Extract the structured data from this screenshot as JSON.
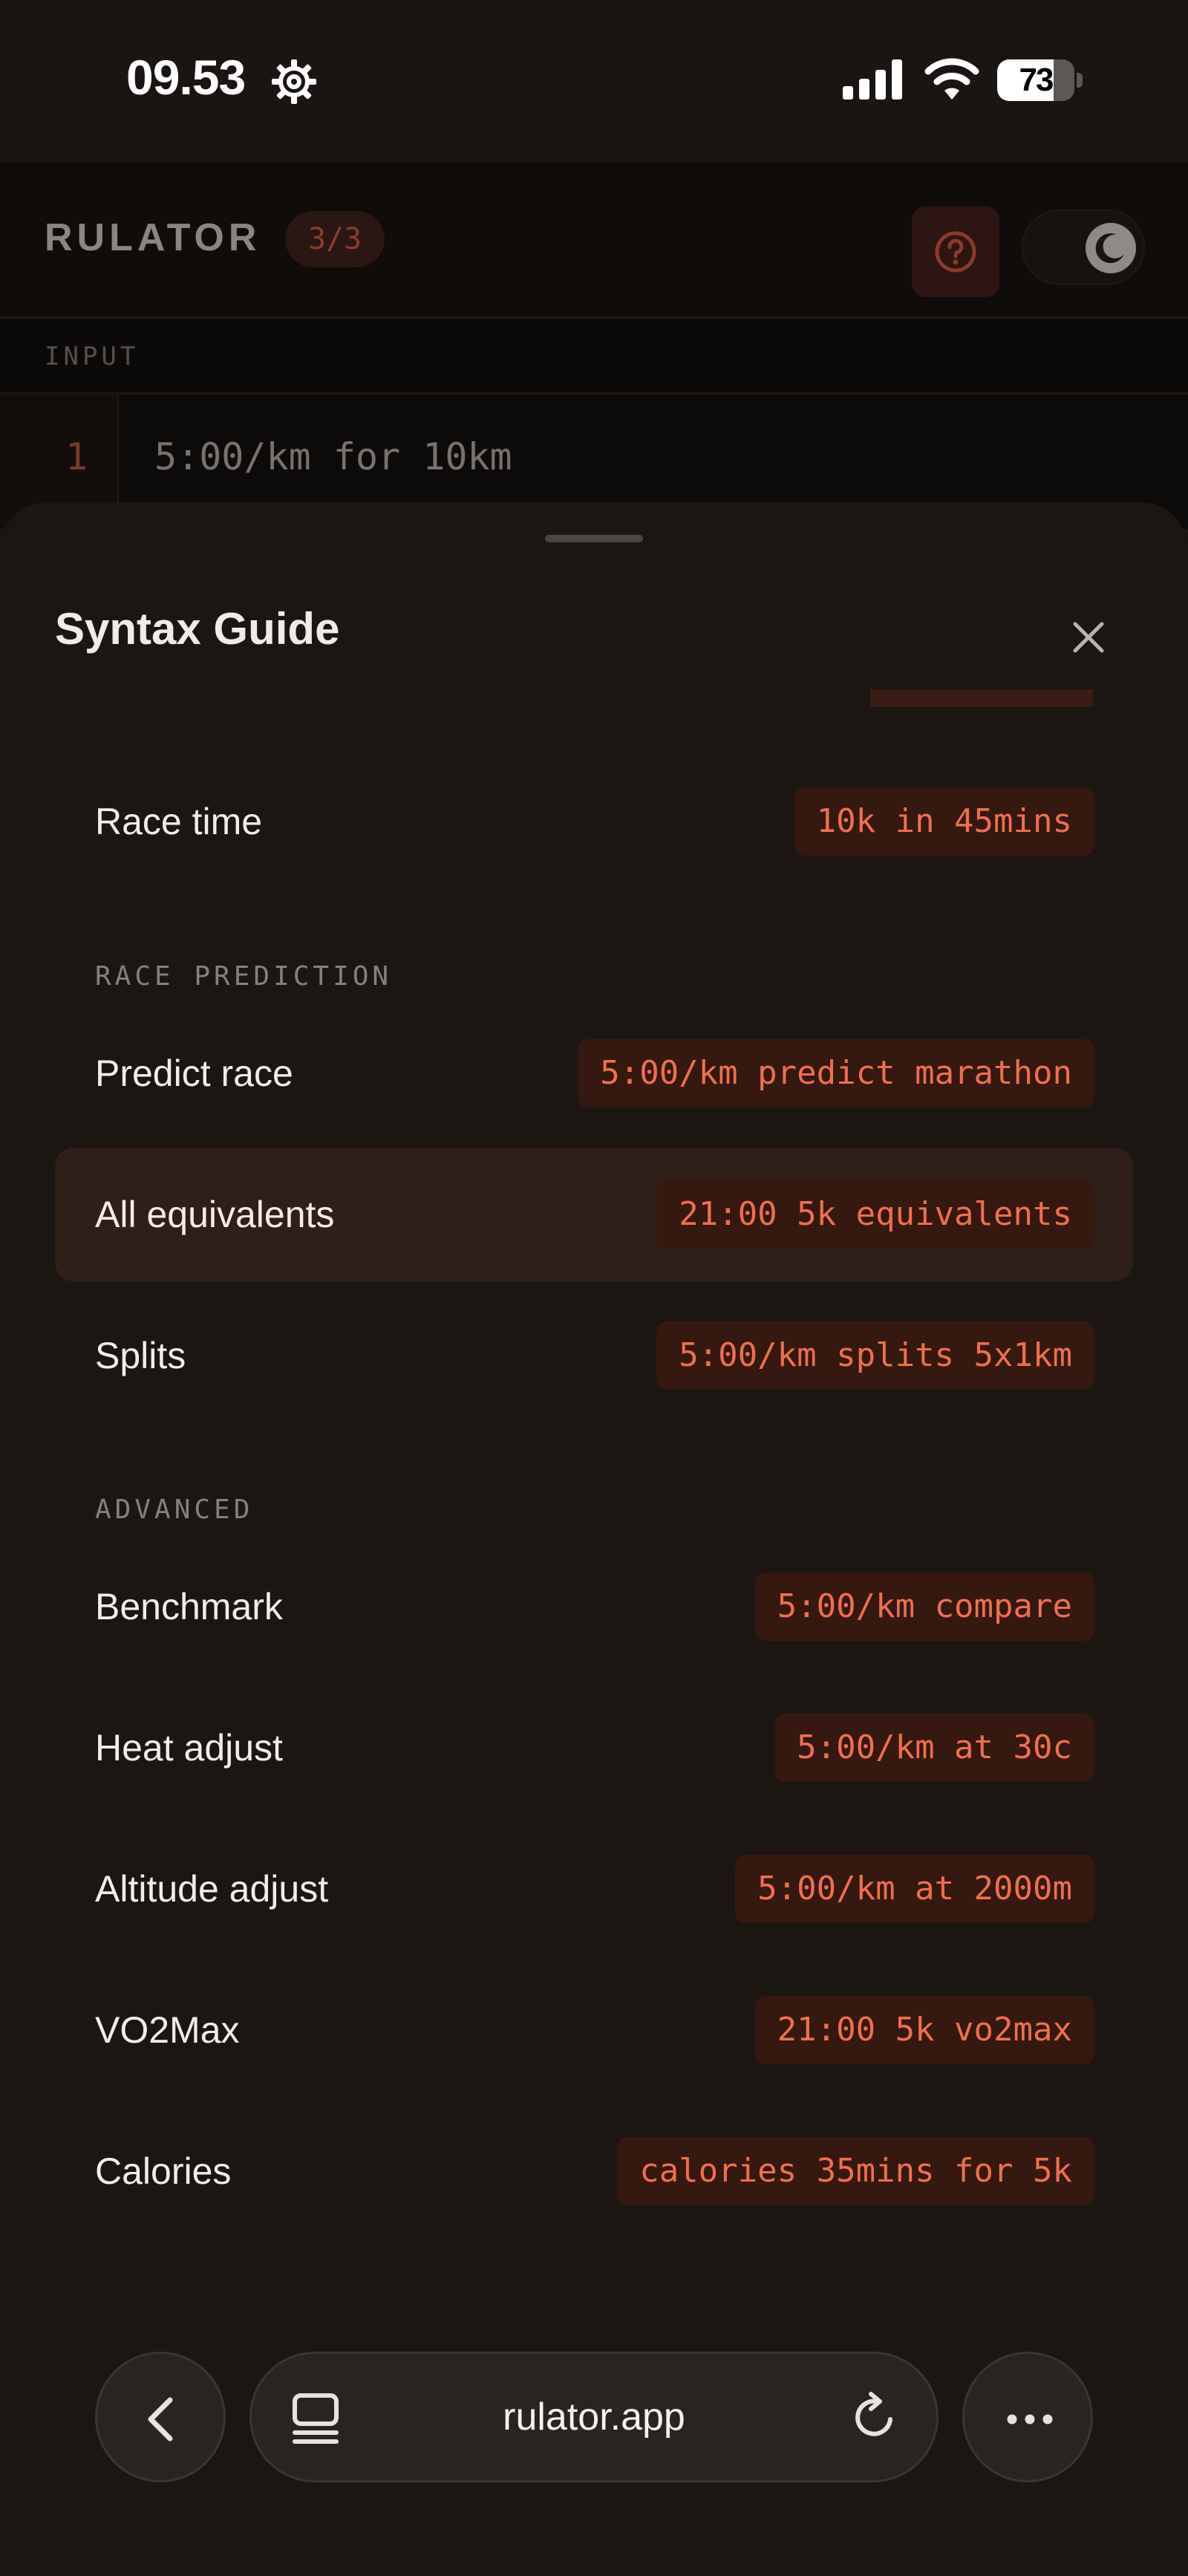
{
  "status_bar": {
    "time": "09.53",
    "battery_level": "73",
    "icons": [
      "gear-icon",
      "cellular-signal-icon",
      "wifi-icon",
      "battery-icon"
    ]
  },
  "app": {
    "title": "RULATOR",
    "counter": "3/3",
    "help_icon": "question-circle-icon",
    "theme_icon": "moon-icon",
    "input_section_label": "INPUT",
    "editor": {
      "line_number": "1",
      "line_text": "5:00/km for 10km"
    },
    "accent_color": "#ef6f4e"
  },
  "sheet": {
    "title": "Syntax Guide",
    "close_icon": "close-icon",
    "rows_top": [
      {
        "label": "Race time",
        "example": "10k in 45mins"
      }
    ],
    "sections": [
      {
        "heading": "RACE PREDICTION",
        "rows": [
          {
            "label": "Predict race",
            "example": "5:00/km predict marathon"
          },
          {
            "label": "All equivalents",
            "example": "21:00 5k equivalents",
            "highlighted": true
          },
          {
            "label": "Splits",
            "example": "5:00/km splits 5x1km"
          }
        ]
      },
      {
        "heading": "ADVANCED",
        "rows": [
          {
            "label": "Benchmark",
            "example": "5:00/km compare"
          },
          {
            "label": "Heat adjust",
            "example": "5:00/km at 30c"
          },
          {
            "label": "Altitude adjust",
            "example": "5:00/km at 2000m"
          },
          {
            "label": "VO2Max",
            "example": "21:00 5k vo2max"
          },
          {
            "label": "Calories",
            "example": "calories 35mins for 5k"
          }
        ]
      }
    ]
  },
  "browser": {
    "url": "rulator.app",
    "icons": [
      "chevron-left-icon",
      "tabs-icon",
      "reload-icon",
      "more-icon"
    ]
  }
}
